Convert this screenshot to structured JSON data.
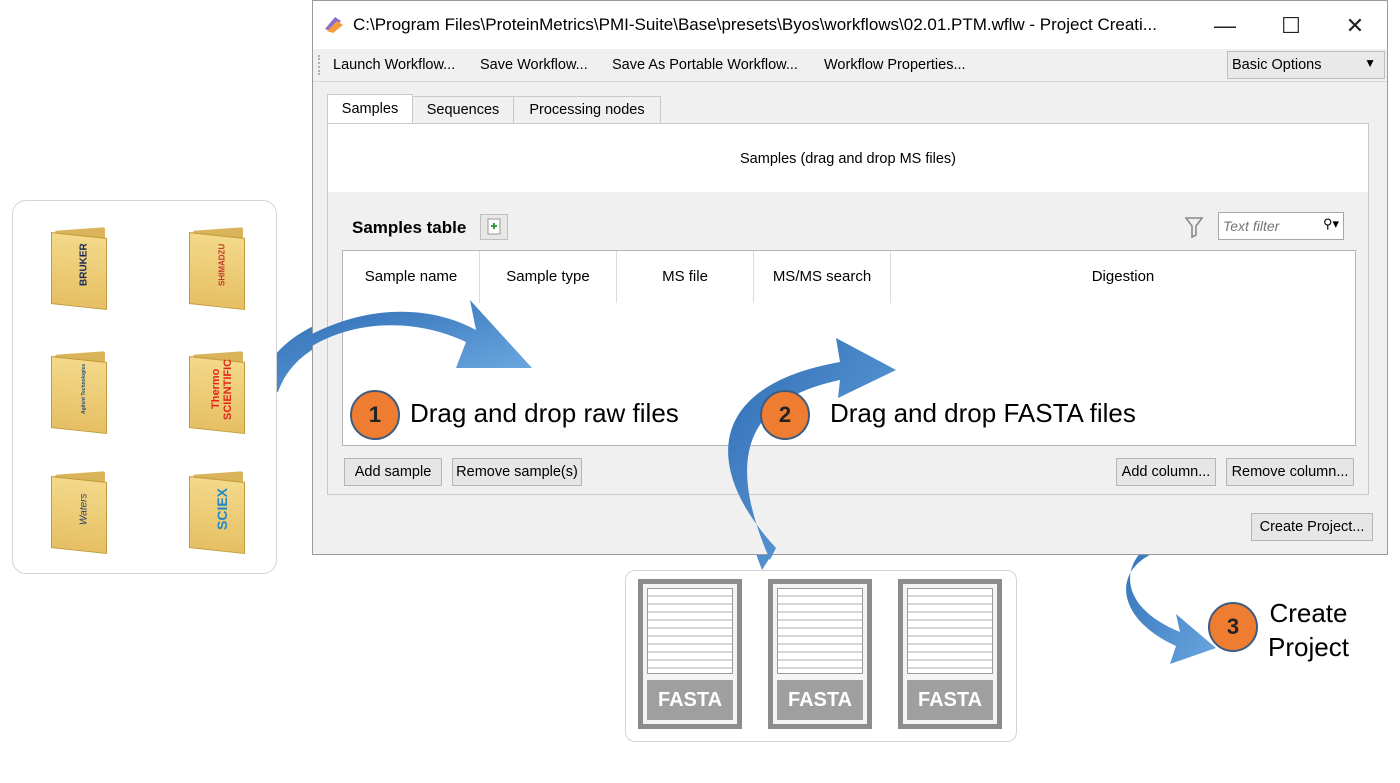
{
  "window": {
    "title": "C:\\Program Files\\ProteinMetrics\\PMI-Suite\\Base\\presets\\Byos\\workflows\\02.01.PTM.wflw - Project Creati...",
    "minimize": "—",
    "maximize": "☐",
    "close": "✕"
  },
  "toolbar": {
    "items": [
      "Launch Workflow...",
      "Save Workflow...",
      "Save As Portable Workflow...",
      "Workflow Properties..."
    ],
    "options_select": "Basic Options"
  },
  "tabs": [
    "Samples",
    "Sequences",
    "Processing nodes"
  ],
  "samples": {
    "drop_hint": "Samples (drag and drop MS files)",
    "table_label": "Samples table",
    "filter_placeholder": "Text filter",
    "columns": [
      "Sample name",
      "Sample type",
      "MS file",
      "MS/MS search",
      "Digestion"
    ],
    "buttons": {
      "add_sample": "Add sample",
      "remove_sample": "Remove sample(s)",
      "add_column": "Add column...",
      "remove_column": "Remove column..."
    }
  },
  "create_project_button": "Create Project...",
  "steps": [
    {
      "number": "1",
      "text": "Drag and drop raw files"
    },
    {
      "number": "2",
      "text": "Drag and drop FASTA files"
    },
    {
      "number": "3",
      "text": "Create\nProject"
    }
  ],
  "vendors": [
    "BRUKER",
    "SHIMADZU",
    "Agilent Technologies",
    "Thermo SCIENTIFIC",
    "Waters",
    "SCIEX"
  ],
  "fasta_files": [
    "FASTA",
    "FASTA",
    "FASTA"
  ],
  "colors": {
    "arrow": "#4a86c8",
    "step_circle": "#ee7d31",
    "thermo": "#e1261c",
    "sciex": "#1e88c8"
  }
}
